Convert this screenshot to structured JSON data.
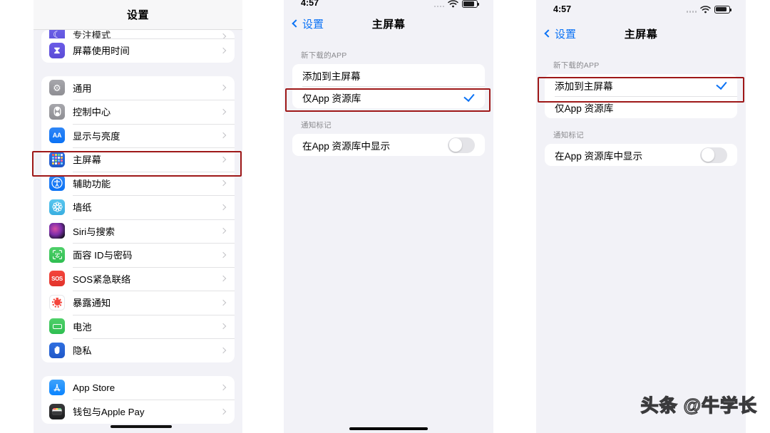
{
  "meta": {
    "watermark": "头条 @牛学长"
  },
  "left_panel": {
    "nav_title": "设置",
    "groups": [
      {
        "rows": [
          {
            "label": "专注模式",
            "icon": "focus-icon",
            "icon_class": "ic-focus",
            "glyph": "☾",
            "clipped": true
          },
          {
            "label": "屏幕使用时间",
            "icon": "hourglass-icon",
            "icon_class": "ic-hourglass",
            "glyph": "⧗",
            "clipped": false
          }
        ]
      },
      {
        "rows": [
          {
            "label": "通用",
            "icon": "gear-icon",
            "icon_class": "ic-general",
            "glyph": "⚙",
            "clipped": false
          },
          {
            "label": "控制中心",
            "icon": "control-center-icon",
            "icon_class": "ic-control",
            "glyph": "◉",
            "clipped": false
          },
          {
            "label": "显示与亮度",
            "icon": "display-brightness-icon",
            "icon_class": "ic-display",
            "glyph": "AA",
            "clipped": false
          },
          {
            "label": "主屏幕",
            "icon": "home-screen-icon",
            "icon_class": "ic-home",
            "glyph": "",
            "clipped": false,
            "highlighted": true
          },
          {
            "label": "辅助功能",
            "icon": "accessibility-icon",
            "icon_class": "ic-access",
            "glyph": "◍",
            "clipped": false
          },
          {
            "label": "墙纸",
            "icon": "wallpaper-icon",
            "icon_class": "ic-wallpaper",
            "glyph": "❋",
            "clipped": false
          },
          {
            "label": "Siri与搜索",
            "icon": "siri-icon",
            "icon_class": "ic-siri",
            "glyph": "",
            "clipped": false
          },
          {
            "label": "面容 ID与密码",
            "icon": "face-id-icon",
            "icon_class": "ic-faceid",
            "glyph": "☺",
            "clipped": false
          },
          {
            "label": "SOS紧急联络",
            "icon": "sos-icon",
            "icon_class": "ic-sos",
            "glyph": "SOS",
            "clipped": false
          },
          {
            "label": "暴露通知",
            "icon": "exposure-notification-icon",
            "icon_class": "ic-exposure",
            "glyph": "",
            "clipped": false
          },
          {
            "label": "电池",
            "icon": "battery-icon",
            "icon_class": "ic-battery",
            "glyph": "",
            "clipped": false
          },
          {
            "label": "隐私",
            "icon": "privacy-icon",
            "icon_class": "ic-privacy",
            "glyph": "✋",
            "clipped": false
          }
        ]
      },
      {
        "rows": [
          {
            "label": "App Store",
            "icon": "app-store-icon",
            "icon_class": "ic-appstore",
            "glyph": "A",
            "clipped": false
          },
          {
            "label": "钱包与Apple Pay",
            "icon": "wallet-icon",
            "icon_class": "ic-wallet",
            "glyph": "▤",
            "clipped": false
          }
        ]
      }
    ]
  },
  "mid_panel": {
    "status": {
      "time": "4:57"
    },
    "nav_back": "设置",
    "nav_title": "主屏幕",
    "section1_header": "新下载的APP",
    "options": [
      {
        "label": "添加到主屏幕",
        "checked": false
      },
      {
        "label": "仅App 资源库",
        "checked": true
      }
    ],
    "section2_header": "通知标记",
    "toggle_row": {
      "label": "在App 资源库中显示",
      "on": false
    }
  },
  "right_panel": {
    "status": {
      "time": "4:57"
    },
    "nav_back": "设置",
    "nav_title": "主屏幕",
    "section1_header": "新下载的APP",
    "options": [
      {
        "label": "添加到主屏幕",
        "checked": true
      },
      {
        "label": "仅App 资源库",
        "checked": false
      }
    ],
    "section2_header": "通知标记",
    "toggle_row": {
      "label": "在App 资源库中显示",
      "on": false
    }
  },
  "colors": {
    "accent_blue": "#0a72f5",
    "highlight_red": "#9e1818",
    "panel_bg": "#f2f2f7",
    "card_bg": "#ffffff"
  }
}
